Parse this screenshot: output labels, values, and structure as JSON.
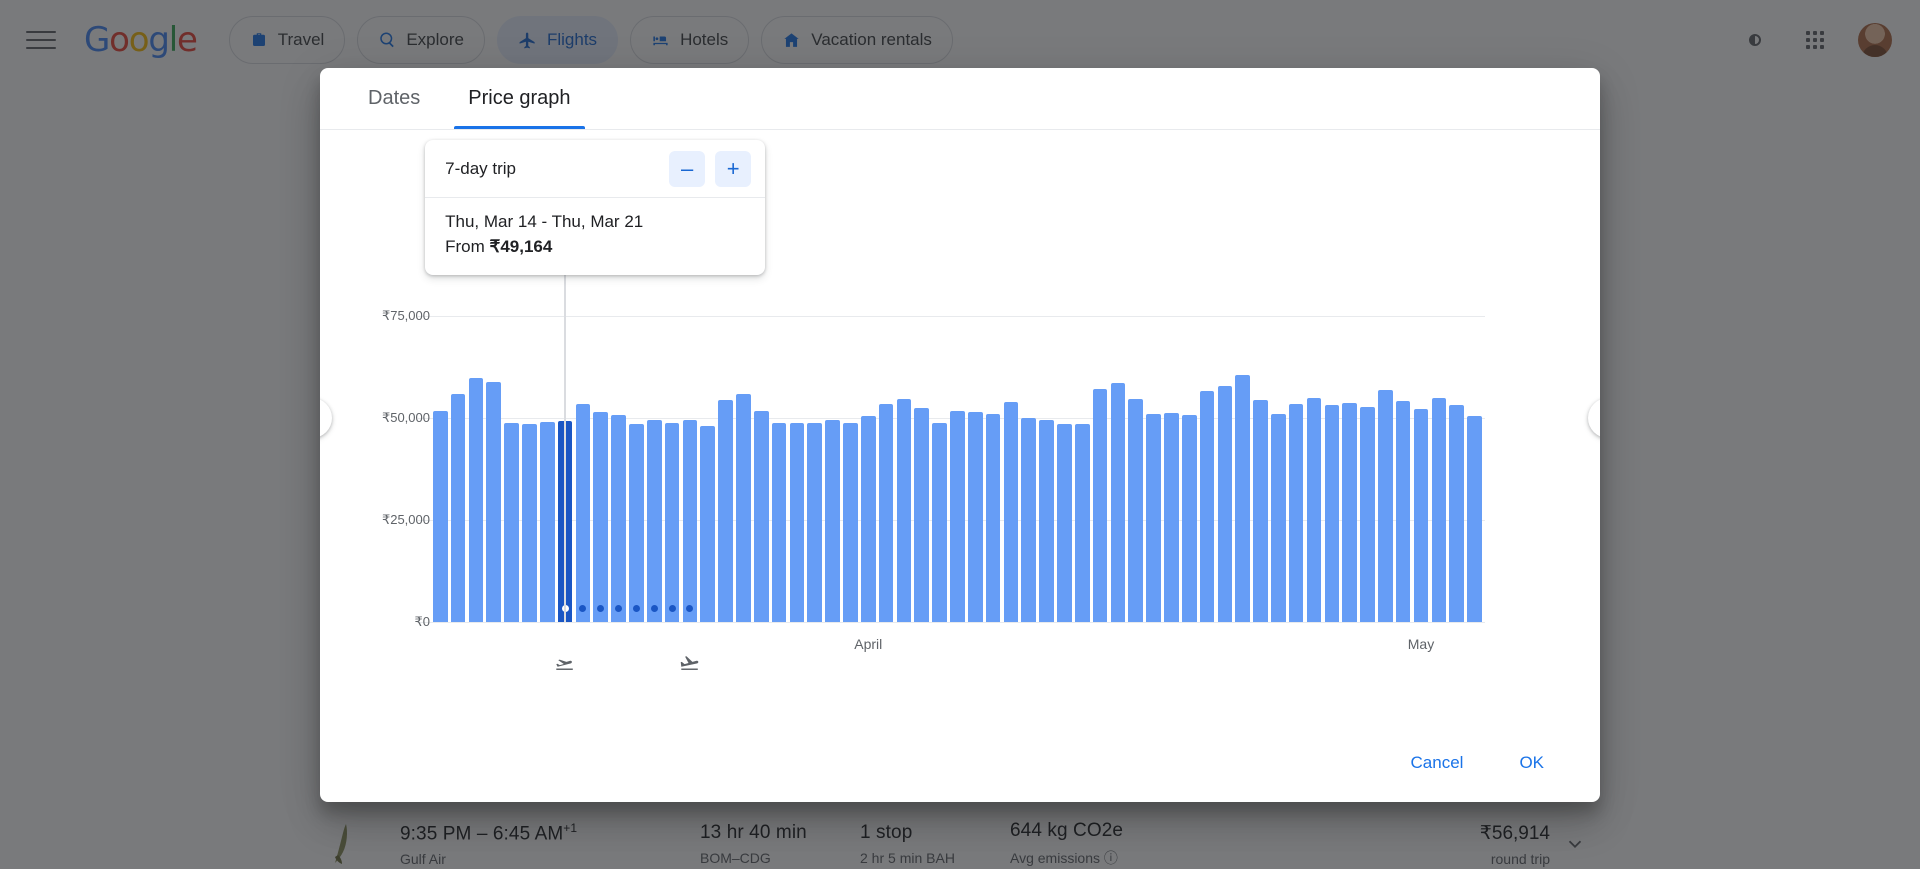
{
  "topnav": {
    "menu_icon": "hamburger-menu-icon",
    "logo_text": "Google",
    "pills": [
      {
        "label": "Travel",
        "icon": "suitcase-icon",
        "active": false
      },
      {
        "label": "Explore",
        "icon": "explore-compass-icon",
        "active": false
      },
      {
        "label": "Flights",
        "icon": "airplane-icon",
        "active": true
      },
      {
        "label": "Hotels",
        "icon": "bed-icon",
        "active": false
      },
      {
        "label": "Vacation rentals",
        "icon": "house-icon",
        "active": false
      }
    ],
    "right_icons": [
      "dark-mode-icon",
      "google-apps-grid-icon",
      "account-avatar"
    ]
  },
  "dialog": {
    "tabs": [
      {
        "label": "Dates",
        "selected": false
      },
      {
        "label": "Price graph",
        "selected": true
      }
    ],
    "tooltip": {
      "trip_length_label": "7-day trip",
      "decrease_label": "–",
      "increase_label": "+",
      "date_range": "Thu, Mar 14 - Thu, Mar 21",
      "from_prefix": "From ",
      "from_price": "₹49,164"
    },
    "footer": {
      "cancel_label": "Cancel",
      "ok_label": "OK"
    },
    "prev_icon": "chevron-left-icon",
    "next_icon": "chevron-right-icon",
    "depart_icon": "flight-takeoff-icon",
    "return_icon": "flight-land-icon"
  },
  "colors": {
    "bar": "#669df6",
    "bar_selected": "#1a56c4",
    "accent": "#1a73e8",
    "grid": "#e8eaed",
    "muted_text": "#5f6368"
  },
  "chart_data": {
    "type": "bar",
    "title": "Price graph",
    "xlabel": "",
    "ylabel": "",
    "ylim": [
      0,
      82000
    ],
    "grid": true,
    "yticks": [
      0,
      25000,
      50000,
      75000
    ],
    "ytick_labels": [
      "₹0",
      "₹25,000",
      "₹50,000",
      "₹75,000"
    ],
    "month_labels": [
      {
        "label": "April",
        "index": 24
      },
      {
        "label": "May",
        "index": 55
      }
    ],
    "selected_index": 7,
    "trip_span_indices": [
      7,
      8,
      9,
      10,
      11,
      12,
      13,
      14
    ],
    "currency": "₹",
    "values": [
      51600,
      55800,
      59700,
      58900,
      48800,
      48500,
      49000,
      49164,
      53500,
      51500,
      50700,
      48600,
      49400,
      48900,
      49600,
      48000,
      54500,
      55800,
      51700,
      48800,
      48700,
      48800,
      49400,
      48800,
      50600,
      53400,
      54700,
      52500,
      48900,
      51800,
      51500,
      51000,
      53900,
      49900,
      49400,
      48500,
      48500,
      57200,
      58600,
      54600,
      51100,
      51200,
      50700,
      56500,
      57900,
      60600,
      54500,
      50900,
      53400,
      54800,
      53200,
      53600,
      52700,
      56900,
      54200,
      52300,
      55000,
      53300,
      50600
    ]
  },
  "result_row": {
    "airline_logo": "gulf-air-logo",
    "times": "9:35 PM – 6:45 AM",
    "times_superscript": "+1",
    "airline": "Gulf Air",
    "duration": "13 hr 40 min",
    "route": "BOM–CDG",
    "stops": "1 stop",
    "stop_detail": "2 hr 5 min BAH",
    "emissions": "644 kg CO2e",
    "emissions_label": "Avg emissions",
    "emissions_info_icon": "info-icon",
    "price": "₹56,914",
    "price_note": "round trip",
    "expand_icon": "chevron-down-icon"
  }
}
